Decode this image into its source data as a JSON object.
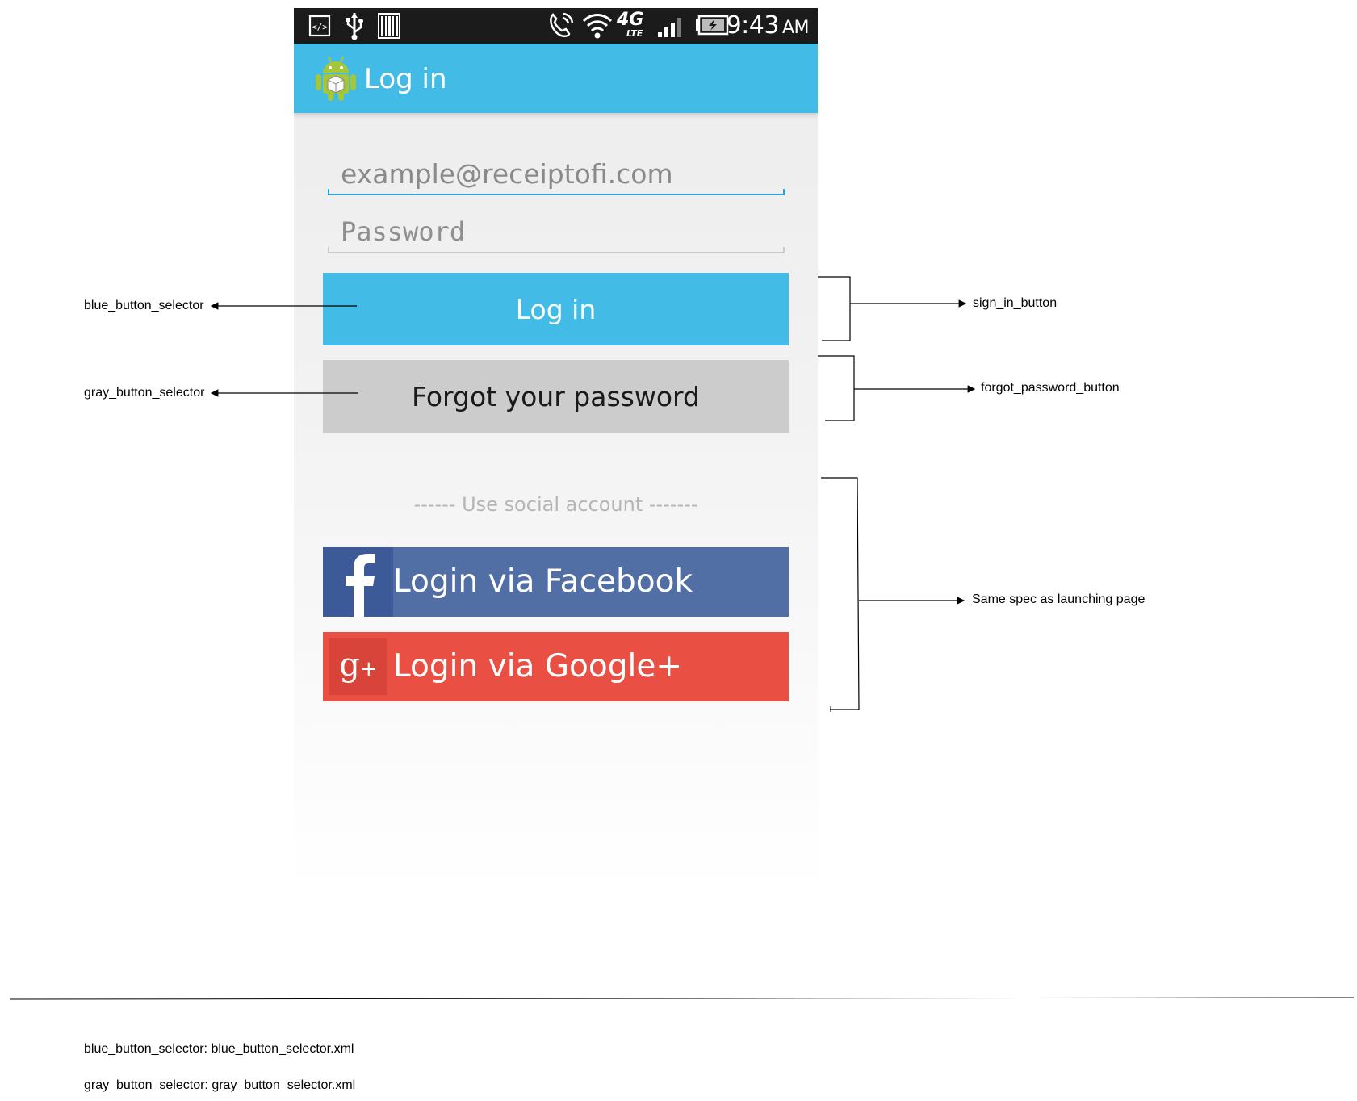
{
  "status_bar": {
    "time": "9:43",
    "ampm": "AM",
    "network": "4G",
    "network_sub": "LTE",
    "icons": [
      "code-icon",
      "usb-icon",
      "barcode-icon",
      "call-icon",
      "wifi-icon",
      "network-4g-lte-icon",
      "signal-icon",
      "battery-charging-icon"
    ]
  },
  "action_bar": {
    "title": "Log in",
    "logo_icon": "android-robot-icon"
  },
  "form": {
    "email_value": "example@receiptofi.com",
    "password_placeholder": "Password",
    "sign_in_label": "Log in",
    "forgot_label": "Forgot your password",
    "social_separator": "------ Use social account -------",
    "facebook_label": "Login via Facebook",
    "google_label": "Login via Google+"
  },
  "annotations": {
    "blue_selector": "blue_button_selector",
    "gray_selector": "gray_button_selector",
    "sign_in_button": "sign_in_button",
    "forgot_password_button": "forgot_password_button",
    "same_spec": "Same spec as launching page",
    "footnote_blue": "blue_button_selector: blue_button_selector.xml",
    "footnote_gray": "gray_button_selector: gray_button_selector.xml"
  },
  "colors": {
    "accent_blue": "#42bbe6",
    "gray_button": "#cccccc",
    "facebook": "#526fa5",
    "facebook_icon_bg": "#3d5a98",
    "google": "#e94f43",
    "google_icon_bg": "#d9443a",
    "status_bar": "#1b1b1b"
  }
}
